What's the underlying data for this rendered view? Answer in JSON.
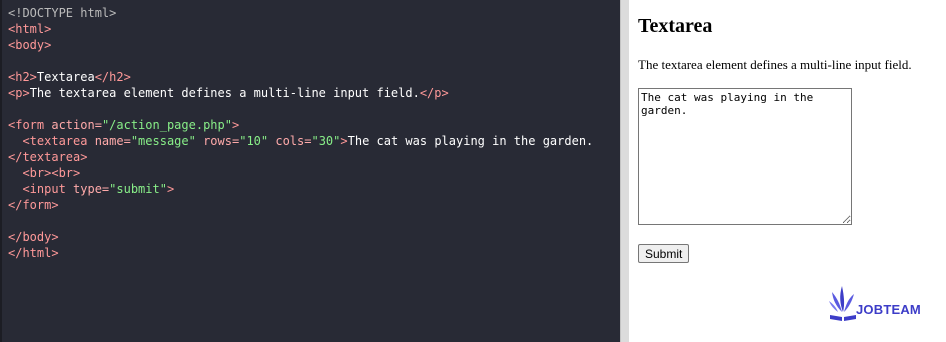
{
  "code_lines": [
    [
      {
        "t": "<!DOCTYPE html>",
        "c": "doctype"
      }
    ],
    [
      {
        "t": "<html>",
        "c": "tag"
      }
    ],
    [
      {
        "t": "<body>",
        "c": "tag"
      }
    ],
    [],
    [
      {
        "t": "<h2>",
        "c": "tag"
      },
      {
        "t": "Textarea",
        "c": "txt"
      },
      {
        "t": "</h2>",
        "c": "tag"
      }
    ],
    [
      {
        "t": "<p>",
        "c": "tag"
      },
      {
        "t": "The textarea element defines a multi-line input field.",
        "c": "txt"
      },
      {
        "t": "</p>",
        "c": "tag"
      }
    ],
    [],
    [
      {
        "t": "<form ",
        "c": "tag"
      },
      {
        "t": "action=",
        "c": "attr"
      },
      {
        "t": "\"/action_page.php\"",
        "c": "val"
      },
      {
        "t": ">",
        "c": "tag"
      }
    ],
    [
      {
        "t": "  <textarea ",
        "c": "tag"
      },
      {
        "t": "name=",
        "c": "attr"
      },
      {
        "t": "\"message\"",
        "c": "val"
      },
      {
        "t": " rows=",
        "c": "attr"
      },
      {
        "t": "\"10\"",
        "c": "val"
      },
      {
        "t": " cols=",
        "c": "attr"
      },
      {
        "t": "\"30\"",
        "c": "val"
      },
      {
        "t": ">",
        "c": "tag"
      },
      {
        "t": "The cat was playing in the garden.",
        "c": "txt"
      }
    ],
    [
      {
        "t": "</textarea>",
        "c": "tag"
      }
    ],
    [
      {
        "t": "  <br><br>",
        "c": "tag"
      }
    ],
    [
      {
        "t": "  <input ",
        "c": "tag"
      },
      {
        "t": "type=",
        "c": "attr"
      },
      {
        "t": "\"submit\"",
        "c": "val"
      },
      {
        "t": ">",
        "c": "tag"
      }
    ],
    [
      {
        "t": "</form>",
        "c": "tag"
      }
    ],
    [],
    [
      {
        "t": "</body>",
        "c": "tag"
      }
    ],
    [
      {
        "t": "</html>",
        "c": "tag"
      }
    ]
  ],
  "preview": {
    "heading": "Textarea",
    "paragraph": "The textarea element defines a multi-line input field.",
    "textarea_value": "The cat was playing in the garden.",
    "submit_label": "Submit"
  },
  "logo": {
    "text": "JOBTEAM",
    "color": "#3d3dc8",
    "icon": "book-leaves-icon"
  },
  "colors": {
    "editor_bg": "#282a35",
    "tag": "#ff9999",
    "value": "#88ee88"
  }
}
